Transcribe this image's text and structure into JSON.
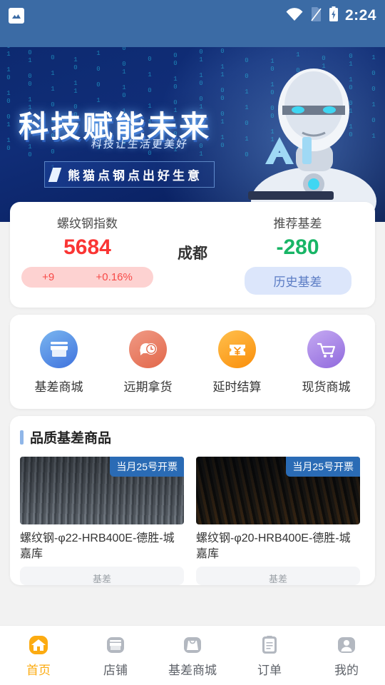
{
  "statusbar": {
    "notification_icon": "image-icon",
    "wifi_icon": "wifi-icon",
    "sim_icon": "no-sim-icon",
    "battery_icon": "battery-charging-icon",
    "time": "2:24"
  },
  "banner": {
    "title": "科技赋能未来",
    "subtitle": "科技让生活更美好",
    "tagline": "熊猫点钢点出好生意",
    "dots": 3,
    "active_dot": 0,
    "accent_dot_color": "#f6a000"
  },
  "price_card": {
    "index_label": "螺纹钢指数",
    "index_value": "5684",
    "index_color": "#fa3534",
    "change_amount": "+9",
    "change_percent": "+0.16%",
    "change_pill_bg": "#fdd2d1",
    "change_pill_color": "#f74a48",
    "city": "成都",
    "basis_label": "推荐基差",
    "basis_value": "-280",
    "basis_color": "#18b566",
    "history_button": "历史基差",
    "history_pill_bg": "#dce6fb",
    "history_pill_color": "#5b7cc4"
  },
  "quick_links": [
    {
      "label": "基差商城",
      "icon": "storefront-icon",
      "color": "#4a7fe0"
    },
    {
      "label": "远期拿货",
      "icon": "chat-clock-icon",
      "color": "#e2674a"
    },
    {
      "label": "延时结算",
      "icon": "yuan-ticket-icon",
      "color": "#fa8e0a"
    },
    {
      "label": "现货商城",
      "icon": "shopping-cart-icon",
      "color": "#9069dd"
    }
  ],
  "product_section": {
    "title": "品质基差商品",
    "accent_color": "#8fb6e8",
    "products": [
      {
        "badge": "当月25号开票",
        "title": "螺纹钢-φ22-HRB400E-德胜-城嘉库",
        "price_text": "基差"
      },
      {
        "badge": "当月25号开票",
        "title": "螺纹钢-φ20-HRB400E-德胜-城嘉库",
        "price_text": "基差"
      }
    ]
  },
  "tabbar": {
    "active_index": 0,
    "active_color": "#fcab11",
    "items": [
      {
        "label": "首页",
        "icon": "home-icon"
      },
      {
        "label": "店铺",
        "icon": "shop-icon"
      },
      {
        "label": "基差商城",
        "icon": "bag-icon"
      },
      {
        "label": "订单",
        "icon": "clipboard-icon"
      },
      {
        "label": "我的",
        "icon": "person-icon"
      }
    ]
  }
}
